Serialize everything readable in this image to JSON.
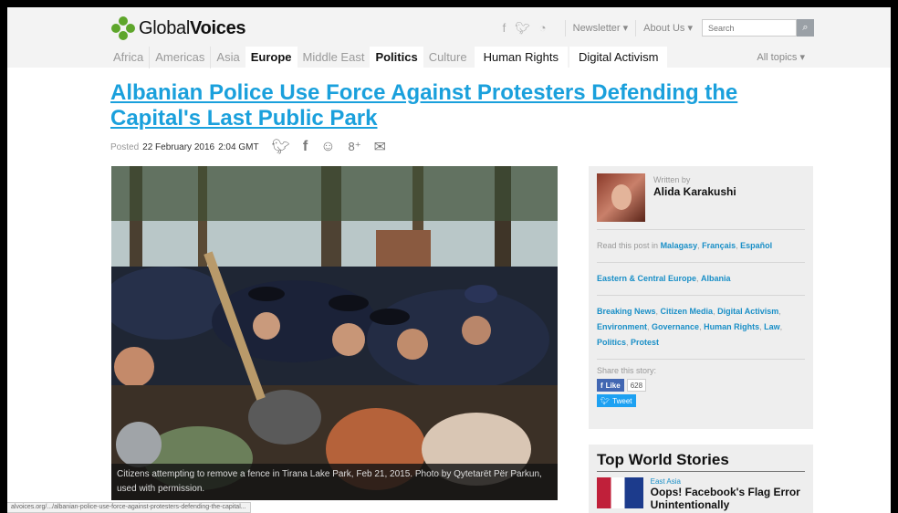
{
  "header": {
    "logo_text_a": "Global",
    "logo_text_b": "Voices",
    "newsletter": "Newsletter ▾",
    "about": "About Us ▾",
    "search_placeholder": "Search"
  },
  "nav": {
    "items": [
      "Africa",
      "Americas",
      "Asia",
      "Europe",
      "Middle East",
      "Politics",
      "Culture",
      "Human Rights",
      "Digital Activism"
    ],
    "all_topics": "All topics ▾"
  },
  "article": {
    "title": "Albanian Police Use Force Against Protesters Defending the Capital's Last Public Park",
    "posted_label": "Posted",
    "posted_date": "22 February 2016",
    "posted_time": "2:04 GMT",
    "caption": "Citizens attempting to remove a fence in Tirana Lake Park, Feb 21, 2015. Photo by Qytetarët Për Parkun, used with permission."
  },
  "sidebar": {
    "written_by": "Written by",
    "author": "Alida Karakushi",
    "read_label": "Read this post in",
    "languages": [
      "Malagasy",
      "Français",
      "Español"
    ],
    "regions": [
      "Eastern & Central Europe",
      "Albania"
    ],
    "topics": [
      "Breaking News",
      "Citizen Media",
      "Digital Activism",
      "Environment",
      "Governance",
      "Human Rights",
      "Law",
      "Politics",
      "Protest"
    ],
    "share_label": "Share this story:",
    "like_label": "Like",
    "like_count": "628",
    "tweet_label": "Tweet"
  },
  "top_world": {
    "heading": "Top World Stories",
    "region": "East Asia",
    "story_title": "Oops! Facebook's Flag Error Unintentionally"
  },
  "status_url": "alvoices.org/.../albanian-police-use-force-against-protesters-defending-the-capital..."
}
